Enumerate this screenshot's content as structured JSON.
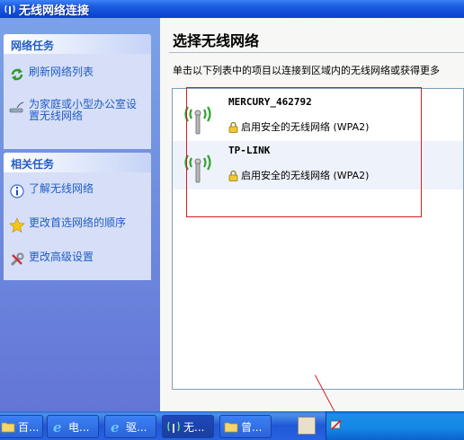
{
  "window": {
    "title": "无线网络连接"
  },
  "left": {
    "network_tasks": {
      "title": "网络任务",
      "items": [
        {
          "label": "刷新网络列表",
          "icon": "refresh-icon"
        },
        {
          "label": "为家庭或小型办公室设置无线网络",
          "icon": "wireless-setup-icon"
        }
      ]
    },
    "related_tasks": {
      "title": "相关任务",
      "items": [
        {
          "label": "了解无线网络",
          "icon": "info-icon"
        },
        {
          "label": "更改首选网络的顺序",
          "icon": "star-icon"
        },
        {
          "label": "更改高级设置",
          "icon": "tools-icon"
        }
      ]
    }
  },
  "main": {
    "title": "选择无线网络",
    "description": "单击以下列表中的项目以连接到区域内的无线网络或获得更多",
    "networks": [
      {
        "ssid": "MERCURY_462792",
        "security": "启用安全的无线网络 (WPA2)"
      },
      {
        "ssid": "TP-LINK",
        "security": "启用安全的无线网络 (WPA2)"
      }
    ]
  },
  "taskbar": {
    "items": [
      {
        "label": "百...",
        "icon": "folder-icon"
      },
      {
        "label": "电...",
        "icon": "ie-icon"
      },
      {
        "label": "驱...",
        "icon": "ie-icon"
      },
      {
        "label": "无...",
        "icon": "wireless-icon"
      },
      {
        "label": "曾...",
        "icon": "folder-icon"
      }
    ]
  },
  "colors": {
    "link": "#215DC6",
    "annotation": "#D02020",
    "titlebar": "#0A3FD0"
  }
}
